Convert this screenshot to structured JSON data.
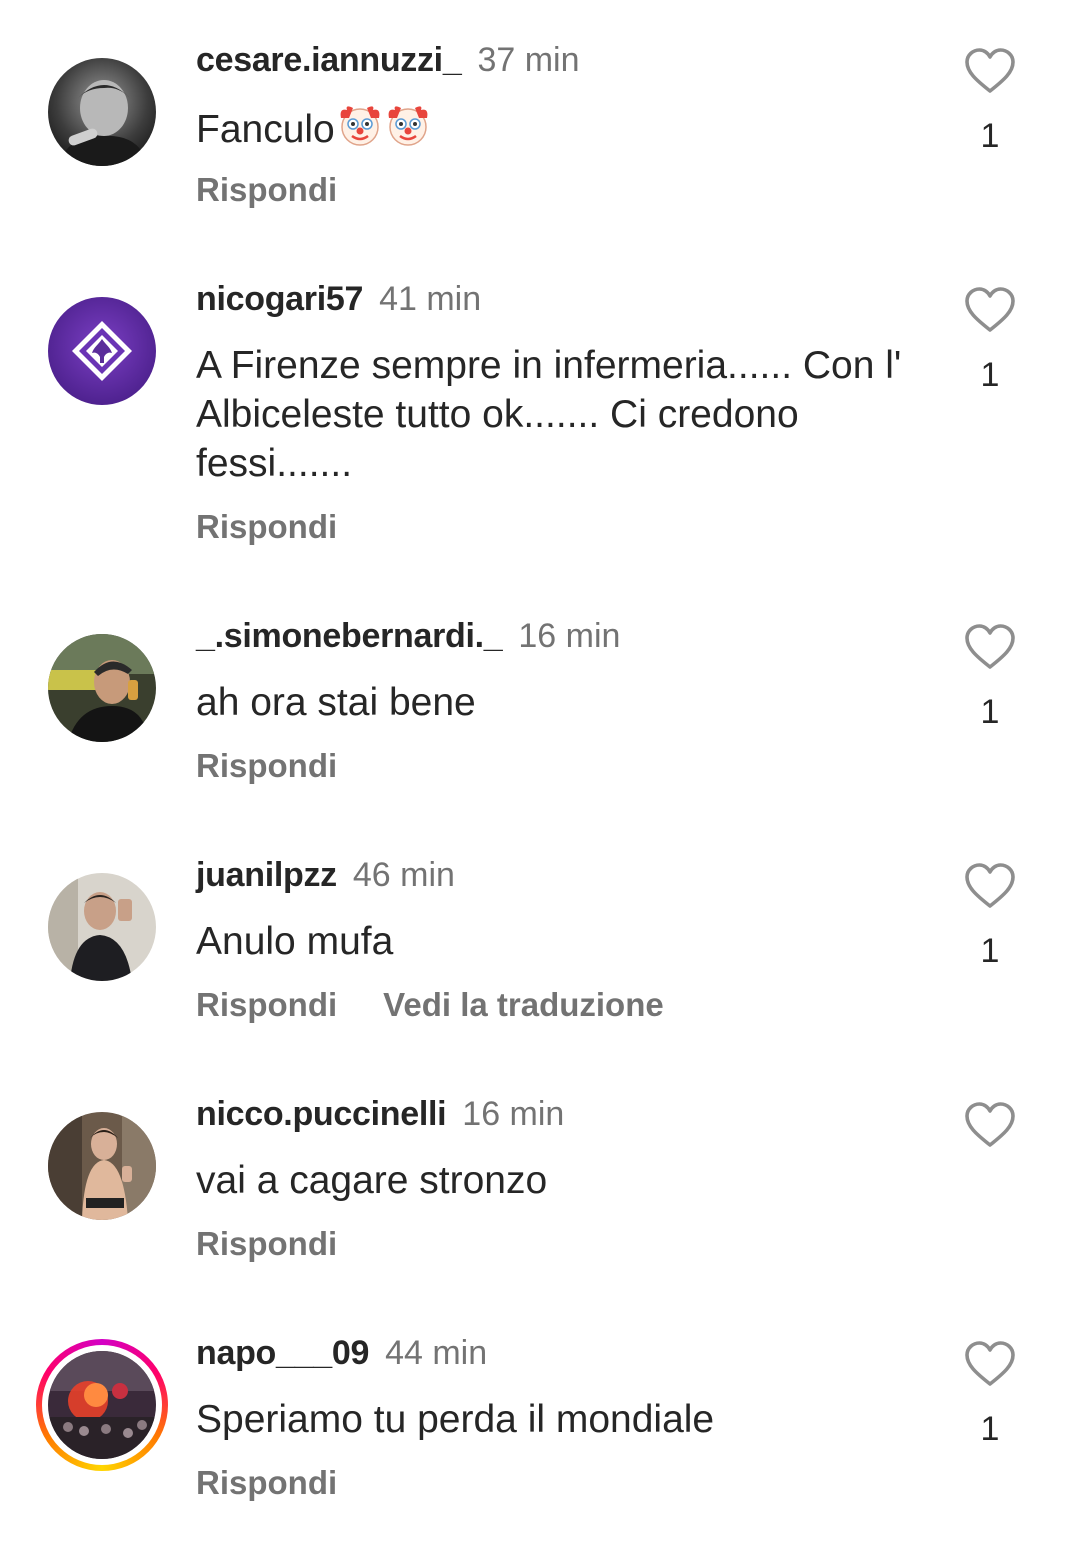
{
  "comments": [
    {
      "username": "cesare.iannuzzi_",
      "time": "37 min",
      "text": "Fanculo",
      "emoji_suffix": [
        "clown-face",
        "clown-face"
      ],
      "reply_label": "Rispondi",
      "likes": "1"
    },
    {
      "username": "nicogari57",
      "time": "41 min",
      "text": "A Firenze sempre in infermeria...... Con l' Albiceleste  tutto ok....... Ci credono fessi.......",
      "reply_label": "Rispondi",
      "likes": "1"
    },
    {
      "username": "_.simonebernardi._",
      "time": "16 min",
      "text": "ah ora stai bene",
      "reply_label": "Rispondi",
      "likes": "1"
    },
    {
      "username": "juanilpzz",
      "time": "46 min",
      "text": "Anulo mufa",
      "reply_label": "Rispondi",
      "translate_label": "Vedi la traduzione",
      "likes": "1"
    },
    {
      "username": "nicco.puccinelli",
      "time": "16 min",
      "text": "vai a cagare stronzo",
      "reply_label": "Rispondi",
      "likes": ""
    },
    {
      "username": "napo___09",
      "time": "44 min",
      "text": "Speriamo tu perda il mondiale",
      "reply_label": "Rispondi",
      "likes": "1"
    }
  ],
  "colors": {
    "text": "#262626",
    "secondary": "#737373",
    "fiorentina_purple": "#5b2d9b",
    "story_ring": [
      "#d300c5",
      "#ff0069",
      "#ff7a00",
      "#ffd600"
    ]
  },
  "icons": {
    "like": "heart-outline-icon"
  }
}
